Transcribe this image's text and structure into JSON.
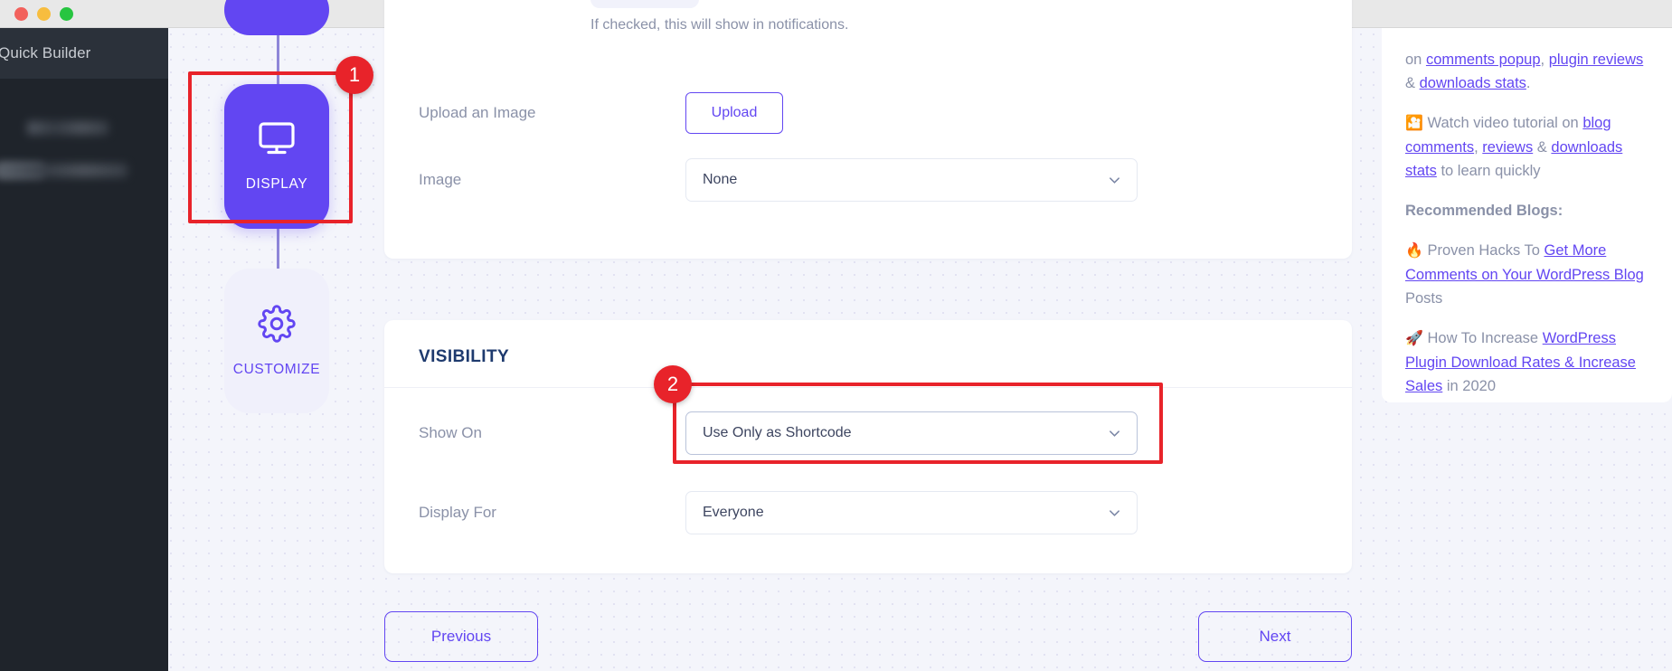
{
  "window": {
    "traffic_lights": [
      "close",
      "minimize",
      "maximize"
    ]
  },
  "dark_sidebar": {
    "title": "Quick Builder",
    "redacted_items": [
      "",
      "",
      ""
    ]
  },
  "step_rail": {
    "steps": [
      {
        "label": "DISPLAY",
        "icon": "monitor-icon",
        "state": "active"
      },
      {
        "label": "CUSTOMIZE",
        "icon": "gear-icon",
        "state": "inactive"
      }
    ]
  },
  "annotations": {
    "badge_1": "1",
    "badge_2": "2",
    "color": "#e8232a"
  },
  "display_card": {
    "helper_text": "If checked, this will show in notifications.",
    "rows": [
      {
        "label": "Upload an Image",
        "control": "button",
        "value": "Upload"
      },
      {
        "label": "Image",
        "control": "select",
        "value": "None"
      }
    ],
    "upload_button_label": "Upload",
    "image_select_value": "None"
  },
  "visibility_card": {
    "title": "VISIBILITY",
    "rows": [
      {
        "label": "Show On",
        "value": "Use Only as Shortcode"
      },
      {
        "label": "Display For",
        "value": "Everyone"
      }
    ],
    "show_on_label": "Show On",
    "show_on_value": "Use Only as Shortcode",
    "display_for_label": "Display For",
    "display_for_value": "Everyone"
  },
  "footer": {
    "previous_label": "Previous",
    "next_label": "Next"
  },
  "info_panel": {
    "para1": {
      "lead": "on ",
      "link1": "comments popup",
      "sep1": ", ",
      "link2": "plugin reviews",
      "sep2": " & ",
      "link3": "downloads stats",
      "tail": "."
    },
    "para2": {
      "emoji": "🎦",
      "lead": " Watch video tutorial on ",
      "link1": "blog comments",
      "sep1": ", ",
      "link2": "reviews",
      "sep2": " & ",
      "link3": "downloads stats",
      "tail": " to learn quickly"
    },
    "heading": "Recommended Blogs:",
    "blog1": {
      "emoji": "🔥",
      "lead": " Proven Hacks To ",
      "link": "Get More Comments on Your WordPress Blog",
      "tail": " Posts"
    },
    "blog2": {
      "emoji": "🚀",
      "lead": " How To Increase ",
      "link": "WordPress Plugin Download Rates & Increase Sales",
      "tail": " in 2020"
    }
  },
  "colors": {
    "accent_purple": "#6246f2",
    "annotation_red": "#e8232a",
    "card_title_navy": "#1e3a6e",
    "label_gray": "#8a91a8",
    "page_bg": "#f4f5fb",
    "dark_sidebar": "#1f242b"
  }
}
